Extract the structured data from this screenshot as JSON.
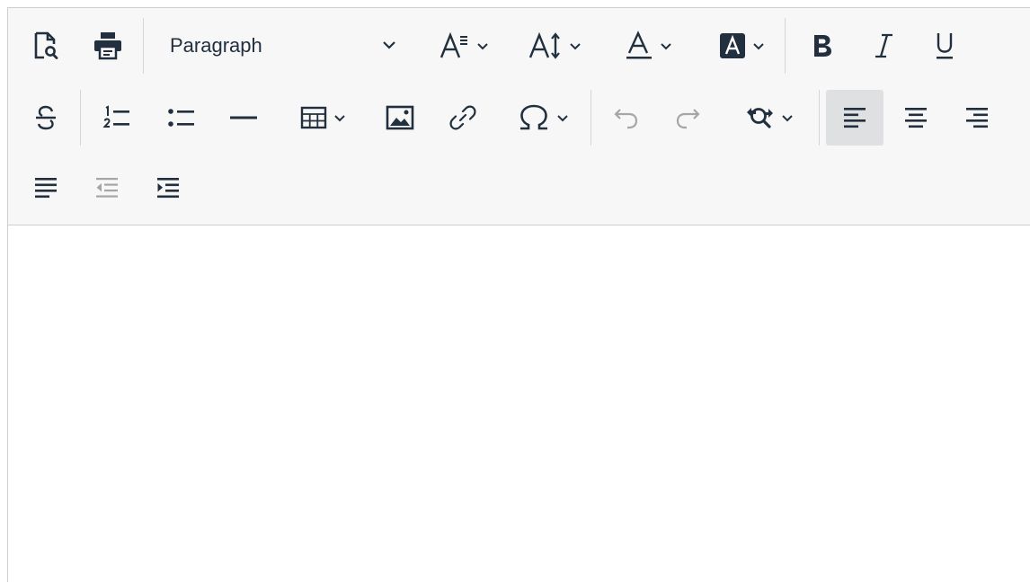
{
  "toolbar": {
    "preview": "preview-icon",
    "print": "print-icon",
    "block_format": {
      "selected_value": "Paragraph"
    },
    "font_family": "font-family-icon",
    "line_height": "line-height-icon",
    "text_color": "text-color-icon",
    "background_color": "highlight-color-icon",
    "bold": "bold-icon",
    "italic": "italic-icon",
    "underline": "underline-icon",
    "strikethrough": "strikethrough-icon",
    "numbered_list": "ordered-list-icon",
    "bulleted_list": "unordered-list-icon",
    "horizontal_line": "horizontal-rule-icon",
    "table": "table-icon",
    "image": "image-icon",
    "link": "link-icon",
    "special_character": "omega-icon",
    "undo": "undo-icon",
    "redo": "redo-icon",
    "find_replace": "search-replace-icon",
    "align_left": "align-left-icon",
    "align_center": "align-center-icon",
    "align_right": "align-right-icon",
    "align_justify": "align-justify-icon",
    "outdent": "outdent-icon",
    "indent": "indent-icon"
  },
  "state": {
    "active_alignment": "align-left",
    "disabled": [
      "undo",
      "redo",
      "outdent"
    ]
  },
  "colors": {
    "toolbar_bg": "#f7f7f7",
    "icon": "#222f3e",
    "disabled_icon": "#a6a6a6",
    "active_bg": "#dee0e2",
    "border": "#cfcfcf"
  }
}
